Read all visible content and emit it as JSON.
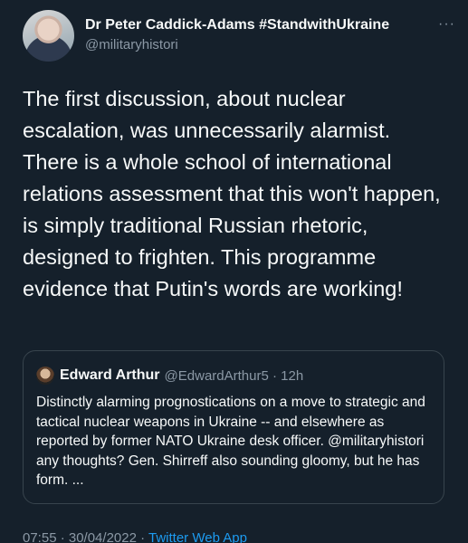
{
  "author": {
    "display_name": "Dr Peter Caddick-Adams #StandwithUkraine",
    "handle": "@militaryhistori"
  },
  "more_label": "···",
  "tweet": {
    "text": "The first discussion, about nuclear escalation, was unnecessarily alarmist. There is a whole school of international relations assessment that this won't happen, is simply traditional Russian rhetoric, designed to frighten. This programme evidence that Putin's words are working!"
  },
  "quoted_tweet": {
    "display_name": "Edward Arthur",
    "handle_time": "@EdwardArthur5 · 12h",
    "text": "Distinctly alarming prognostications on a move to strategic and tactical nuclear weapons in Ukraine -- and elsewhere as reported by former NATO Ukraine desk officer. @militaryhistori any thoughts? Gen. Shirreff also sounding gloomy, but he has form. ..."
  },
  "footer": {
    "timestamp": "07:55 · 30/04/2022 · ",
    "source": "Twitter Web App"
  },
  "colors": {
    "background": "#15202b",
    "text": "#f7f9f9",
    "muted": "#8b98a5",
    "link": "#1d9bf0",
    "border": "#38444d"
  }
}
